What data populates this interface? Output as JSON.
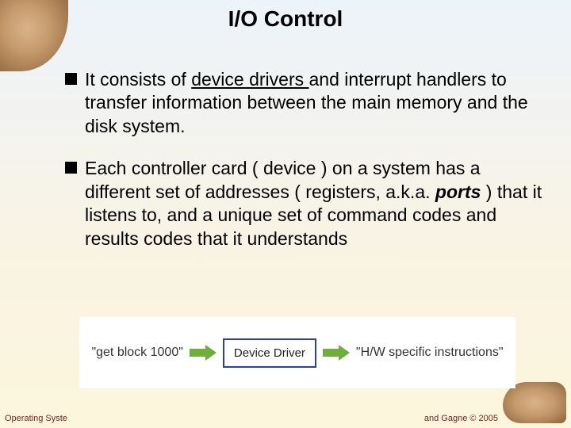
{
  "title": "I/O Control",
  "bullets": [
    {
      "pre": "It consists of ",
      "underlined": "device drivers ",
      "post": "and interrupt handlers to transfer information between the main memory and the disk system."
    },
    {
      "pre": "Each controller card ( device ) on a system has a different set of addresses ( registers, a.k.a. ",
      "bolditalic": "ports",
      "post": " ) that it listens to, and a unique set of command codes and results codes that it understands"
    }
  ],
  "diagram": {
    "left": "\"get block 1000\"",
    "center": "Device Driver",
    "right": "\"H/W specific instructions\""
  },
  "footer": {
    "left": "Operating Syste",
    "right": "and Gagne © 2005"
  }
}
